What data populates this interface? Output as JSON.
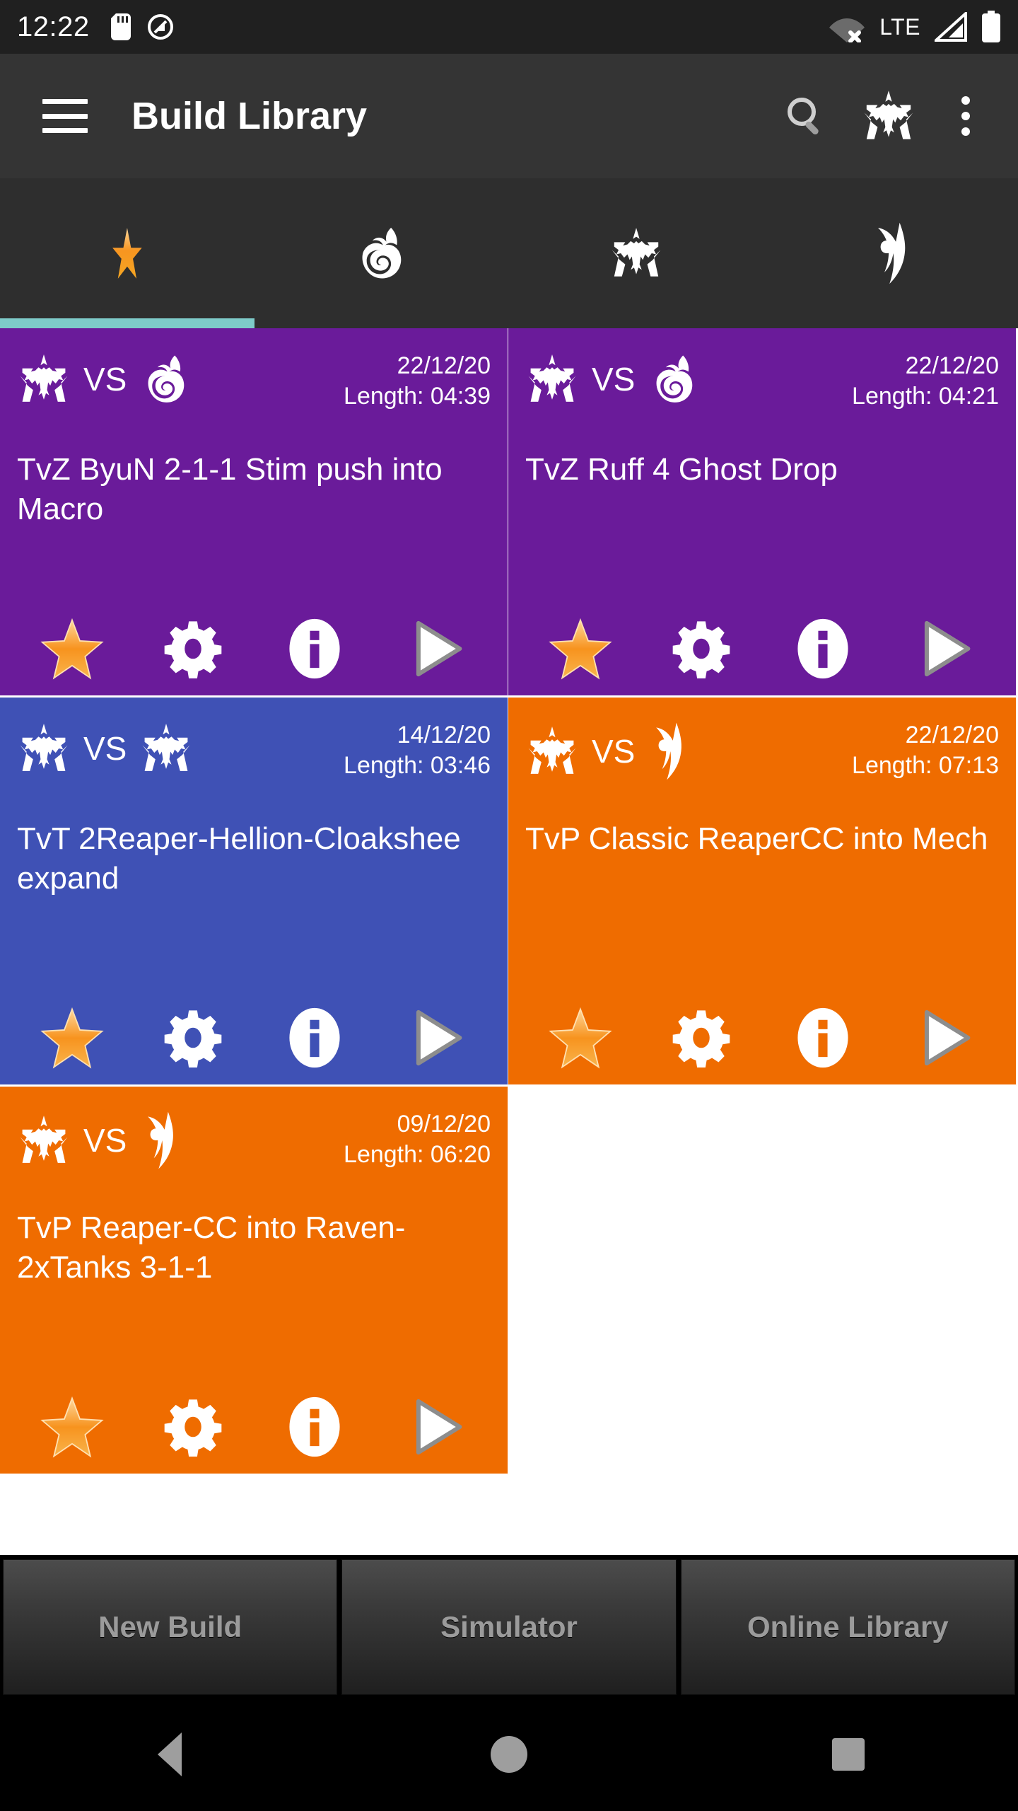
{
  "status_bar": {
    "time": "12:22",
    "left_icons": [
      "sd-card-icon",
      "silent-mode-icon"
    ],
    "network_label": "LTE",
    "right_icons": [
      "wifi-off-icon",
      "cellular-signal-icon",
      "battery-full-icon"
    ]
  },
  "app_bar": {
    "title": "Build Library",
    "menu_icon": "hamburger-menu-icon",
    "actions": [
      {
        "name": "search-icon",
        "label": "Search"
      },
      {
        "name": "terran-race-filter-icon",
        "label": "Terran"
      },
      {
        "name": "overflow-menu-icon",
        "label": "More options"
      }
    ]
  },
  "tabs": {
    "selected_index": 0,
    "items": [
      {
        "name": "tab-favorites",
        "icon": "star-icon",
        "label": "Favorites",
        "selected": true
      },
      {
        "name": "tab-zerg",
        "icon": "zerg-icon",
        "label": "Zerg",
        "selected": false
      },
      {
        "name": "tab-terran",
        "icon": "terran-icon",
        "label": "Terran",
        "selected": false
      },
      {
        "name": "tab-protoss",
        "icon": "protoss-icon",
        "label": "Protoss",
        "selected": false
      }
    ],
    "indicator_color": "#7ecbc9"
  },
  "builds": [
    {
      "title": "TvZ ByuN 2-1-1 Stim push into Macro",
      "player_race": "terran",
      "opponent_race": "zerg",
      "vs_label": "VS",
      "date": "22/12/20",
      "length": "Length: 04:39",
      "color": "#6A1B9A",
      "favorite": true,
      "actions": [
        "star-icon",
        "gear-icon",
        "info-icon",
        "play-icon"
      ]
    },
    {
      "title": "TvZ Ruff 4 Ghost Drop",
      "player_race": "terran",
      "opponent_race": "zerg",
      "vs_label": "VS",
      "date": "22/12/20",
      "length": "Length: 04:21",
      "color": "#6A1B9A",
      "favorite": true,
      "actions": [
        "star-icon",
        "gear-icon",
        "info-icon",
        "play-icon"
      ]
    },
    {
      "title": "TvT 2Reaper-Hellion-Cloakshee expand",
      "player_race": "terran",
      "opponent_race": "terran",
      "vs_label": "VS",
      "date": "14/12/20",
      "length": "Length: 03:46",
      "color": "#3F51B5",
      "favorite": true,
      "actions": [
        "star-icon",
        "gear-icon",
        "info-icon",
        "play-icon"
      ]
    },
    {
      "title": "TvP Classic ReaperCC into Mech",
      "player_race": "terran",
      "opponent_race": "protoss",
      "vs_label": "VS",
      "date": "22/12/20",
      "length": "Length: 07:13",
      "color": "#EF6C00",
      "favorite": true,
      "actions": [
        "star-icon",
        "gear-icon",
        "info-icon",
        "play-icon"
      ]
    },
    {
      "title": "TvP Reaper-CC into Raven-2xTanks 3-1-1",
      "player_race": "terran",
      "opponent_race": "protoss",
      "vs_label": "VS",
      "date": "09/12/20",
      "length": "Length: 06:20",
      "color": "#EF6C00",
      "favorite": true,
      "actions": [
        "star-icon",
        "gear-icon",
        "info-icon",
        "play-icon"
      ]
    }
  ],
  "bottom_buttons": [
    {
      "name": "new-build-button",
      "label": "New Build"
    },
    {
      "name": "simulator-button",
      "label": "Simulator"
    },
    {
      "name": "online-library-button",
      "label": "Online Library"
    }
  ],
  "nav_bar": {
    "back": "back-nav-icon",
    "home": "home-nav-icon",
    "recents": "recents-nav-icon"
  }
}
